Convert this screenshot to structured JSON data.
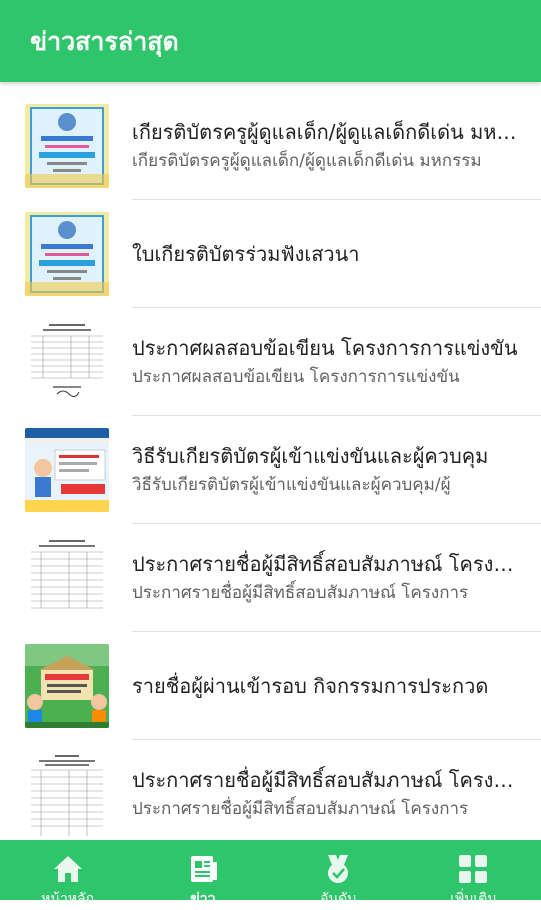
{
  "header": {
    "title": "ข่าวสารล่าสุด"
  },
  "news": [
    {
      "title": "เกียรติบัตรครูผู้ดูแลเด็ก/ผู้ดูแลเด็กดีเด่น มหกรรม",
      "subtitle": "เกียรติบัตรครูผู้ดูแลเด็ก/ผู้ดูแลเด็กดีเด่น มหกรรม",
      "thumb": "certificate-icon"
    },
    {
      "title": "ใบเกียรติบัตรร่วมฟังเสวนา",
      "subtitle": "",
      "thumb": "certificate-icon"
    },
    {
      "title": "ประกาศผลสอบข้อเขียน โครงการการแข่งขัน",
      "subtitle": "ประกาศผลสอบข้อเขียน โครงการการแข่งขัน",
      "thumb": "document-icon"
    },
    {
      "title": "วิธีรับเกียรติบัตรผู้เข้าแข่งขันและผู้ควบคุม",
      "subtitle": "วิธีรับเกียรติบัตรผู้เข้าแข่งขันและผู้ควบคุม/ผู้",
      "thumb": "website-icon"
    },
    {
      "title": "ประกาศรายชื่อผู้มีสิทธิ์สอบสัมภาษณ์ โครงการ",
      "subtitle": "ประกาศรายชื่อผู้มีสิทธิ์สอบสัมภาษณ์ โครงการ",
      "thumb": "document-icon"
    },
    {
      "title": "รายชื่อผู้ผ่านเข้ารอบ กิจกรรมการประกวด",
      "subtitle": "",
      "thumb": "poster-icon"
    },
    {
      "title": "ประกาศรายชื่อผู้มีสิทธิ์สอบสัมภาษณ์ โครงการ",
      "subtitle": "ประกาศรายชื่อผู้มีสิทธิ์สอบสัมภาษณ์ โครงการ",
      "thumb": "document-icon"
    }
  ],
  "bottom_nav": [
    {
      "label": "หน้าหลัก",
      "icon": "home-icon"
    },
    {
      "label": "ข่าว",
      "icon": "news-icon",
      "active": true
    },
    {
      "label": "อันดับ",
      "icon": "medal-icon"
    },
    {
      "label": "เพิ่มเติม",
      "icon": "grid-icon"
    }
  ]
}
